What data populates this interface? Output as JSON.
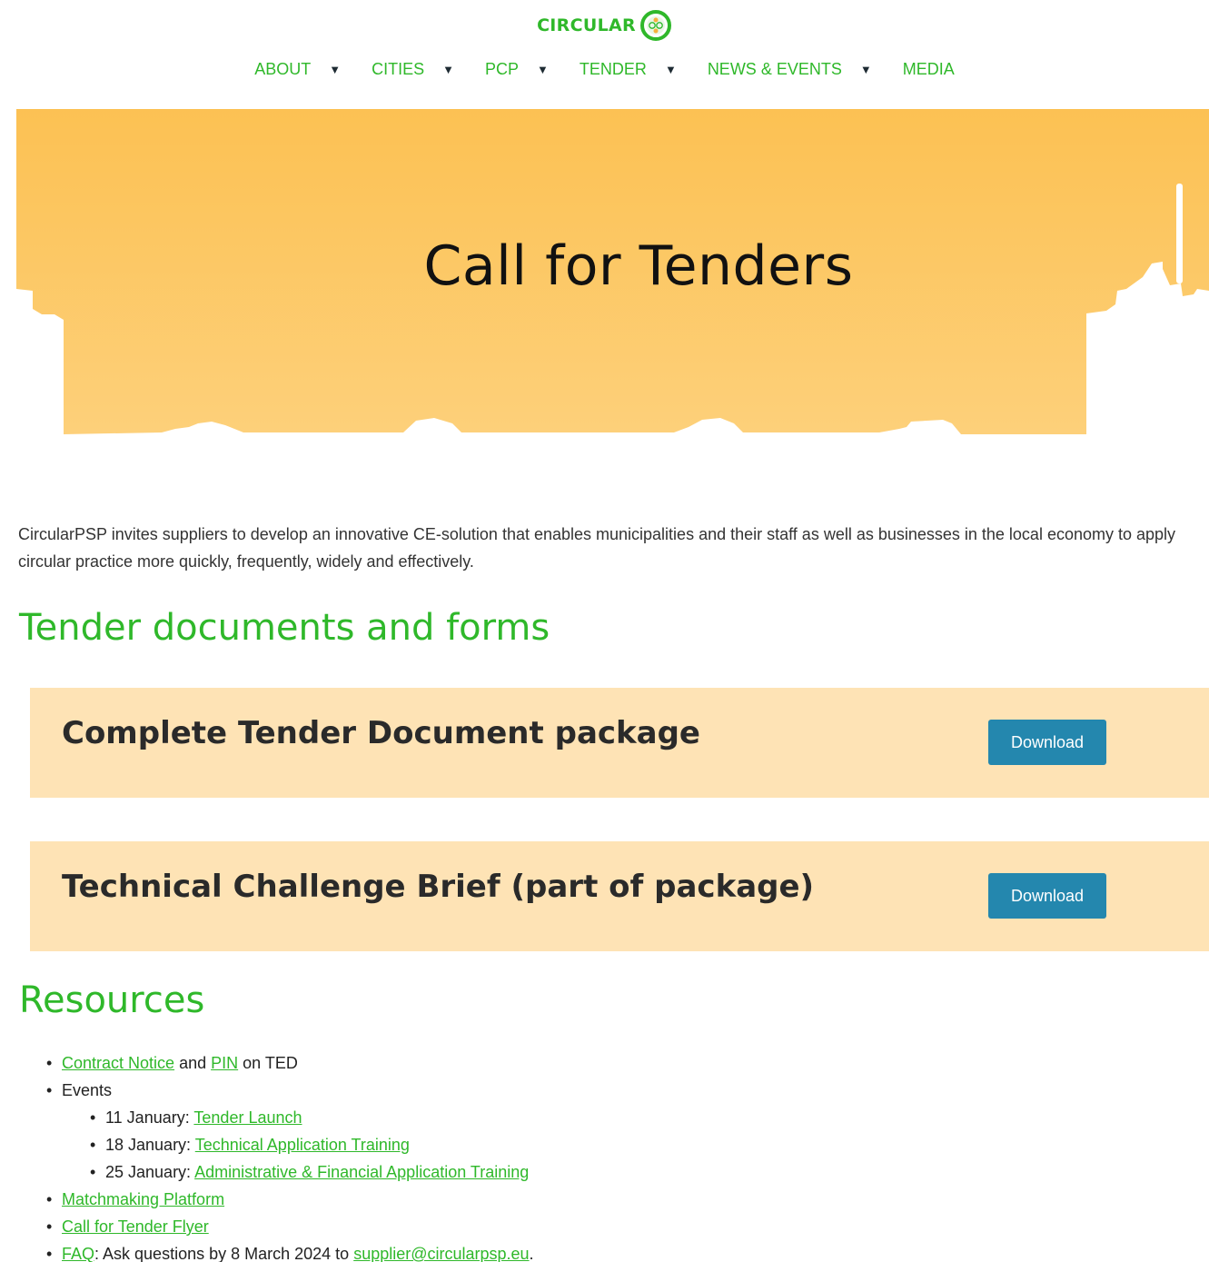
{
  "header": {
    "logo_text": "CIRCULAR",
    "nav": [
      {
        "label": "ABOUT",
        "has_caret": true
      },
      {
        "label": "CITIES",
        "has_caret": true
      },
      {
        "label": "PCP",
        "has_caret": true
      },
      {
        "label": "TENDER",
        "has_caret": true
      },
      {
        "label": "NEWS & EVENTS",
        "has_caret": true
      },
      {
        "label": "MEDIA",
        "has_caret": false
      }
    ],
    "caret_glyph": "▼"
  },
  "hero": {
    "title": "Call for Tenders"
  },
  "intro": "CircularPSP invites suppliers to develop an innovative CE-solution that enables municipalities and their staff as well as businesses in the local economy to apply circular practice more quickly, frequently, widely and effectively.",
  "documents": {
    "heading": "Tender documents and forms",
    "items": [
      {
        "title": "Complete Tender Document package",
        "button": "Download"
      },
      {
        "title": "Technical Challenge Brief (part of package)",
        "button": "Download"
      }
    ]
  },
  "resources": {
    "heading": "Resources",
    "contract_notice_link": "Contract Notice",
    "and_text": " and ",
    "pin_link": "PIN",
    "on_ted_text": " on TED",
    "events_label": "Events",
    "events": [
      {
        "date": "11 January: ",
        "link": "Tender Launch"
      },
      {
        "date": "18 January: ",
        "link": "Technical Application Training"
      },
      {
        "date": "25 January: ",
        "link": "Administrative & Financial Application Training"
      }
    ],
    "matchmaking_link": "Matchmaking Platform",
    "flyer_link": "Call for Tender Flyer",
    "faq_link": "FAQ",
    "faq_text": ": Ask questions by 8 March 2024 to ",
    "email_link": "supplier@circularpsp.eu",
    "period": "."
  },
  "colors": {
    "brand_green": "#2fb82a",
    "hero_orange": "#fcc153",
    "card_bg": "#fee3b5",
    "button_blue": "#2487ae"
  }
}
